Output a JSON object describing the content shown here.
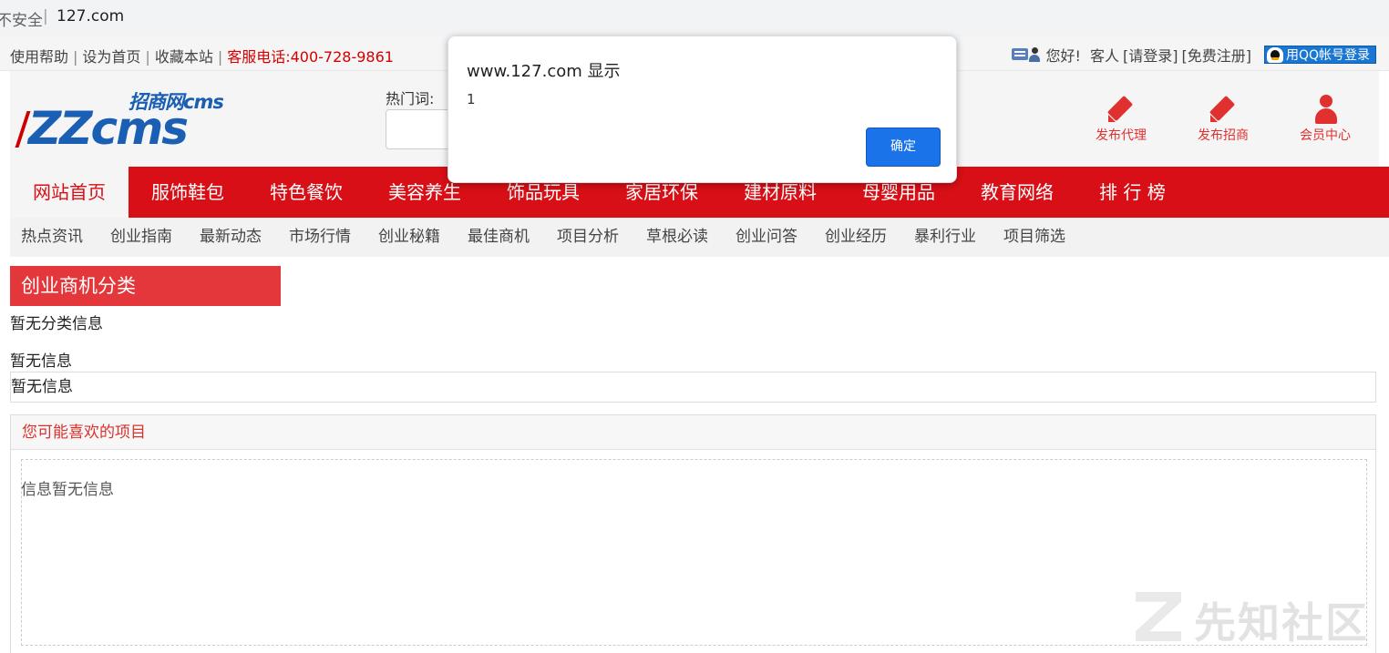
{
  "browser": {
    "security_label": "不安全",
    "separator": "|",
    "url": "127.com"
  },
  "topbar": {
    "links": [
      "使用帮助",
      "设为首页",
      "收藏本站"
    ],
    "divider": "|",
    "phone": "客服电话:400-728-9861",
    "greeting": "您好!",
    "guest": "客人",
    "login": "[请登录]",
    "register": "[免费注册]",
    "qq_login": "用QQ帐号登录"
  },
  "header": {
    "logo_small": "招商网cms",
    "logo_big": "ZZcms",
    "hotwords_label": "热门词:",
    "actions": [
      {
        "label": "发布代理",
        "icon": "pencil-icon"
      },
      {
        "label": "发布招商",
        "icon": "pencil-icon"
      },
      {
        "label": "会员中心",
        "icon": "member-icon"
      }
    ]
  },
  "mainnav": {
    "items": [
      "网站首页",
      "服饰鞋包",
      "特色餐饮",
      "美容养生",
      "饰品玩具",
      "家居环保",
      "建材原料",
      "母婴用品",
      "教育网络",
      "排 行 榜"
    ],
    "active_index": 0
  },
  "subnav": {
    "items": [
      "热点资讯",
      "创业指南",
      "最新动态",
      "市场行情",
      "创业秘籍",
      "最佳商机",
      "项目分析",
      "草根必读",
      "创业问答",
      "创业经历",
      "暴利行业",
      "项目筛选"
    ]
  },
  "content": {
    "category_title": "创业商机分类",
    "category_empty": "暂无分类信息",
    "info_empty": "暂无信息",
    "info_box_text": "暂无信息",
    "like_title": "您可能喜欢的项目",
    "like_body": "信息暂无信息"
  },
  "watermark": {
    "text": "先知社区"
  },
  "dialog": {
    "title": "www.127.com 显示",
    "message": "1",
    "ok_label": "确定"
  },
  "colors": {
    "brand_red": "#d80f16",
    "category_red": "#e4373b",
    "logo_blue": "#1a5fb4",
    "dialog_button": "#1a73e8"
  }
}
